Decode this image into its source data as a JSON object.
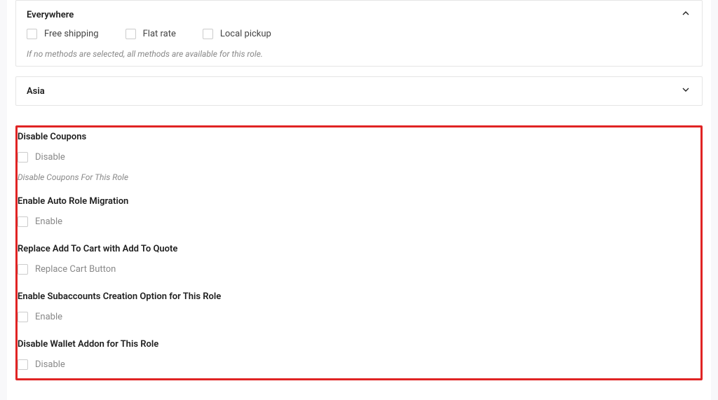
{
  "regions": {
    "everywhere": {
      "title": "Everywhere",
      "methods": {
        "free_shipping": "Free shipping",
        "flat_rate": "Flat rate",
        "local_pickup": "Local pickup"
      },
      "help": "If no methods are selected, all methods are available for this role."
    },
    "asia": {
      "title": "Asia"
    }
  },
  "settings": {
    "disable_coupons": {
      "title": "Disable Coupons",
      "option": "Disable",
      "desc": "Disable Coupons For This Role"
    },
    "auto_role_migration": {
      "title": "Enable Auto Role Migration",
      "option": "Enable"
    },
    "replace_cart": {
      "title": "Replace Add To Cart with Add To Quote",
      "option": "Replace Cart Button"
    },
    "subaccounts": {
      "title": "Enable Subaccounts Creation Option for This Role",
      "option": "Enable"
    },
    "disable_wallet": {
      "title": "Disable Wallet Addon for This Role",
      "option": "Disable"
    }
  }
}
